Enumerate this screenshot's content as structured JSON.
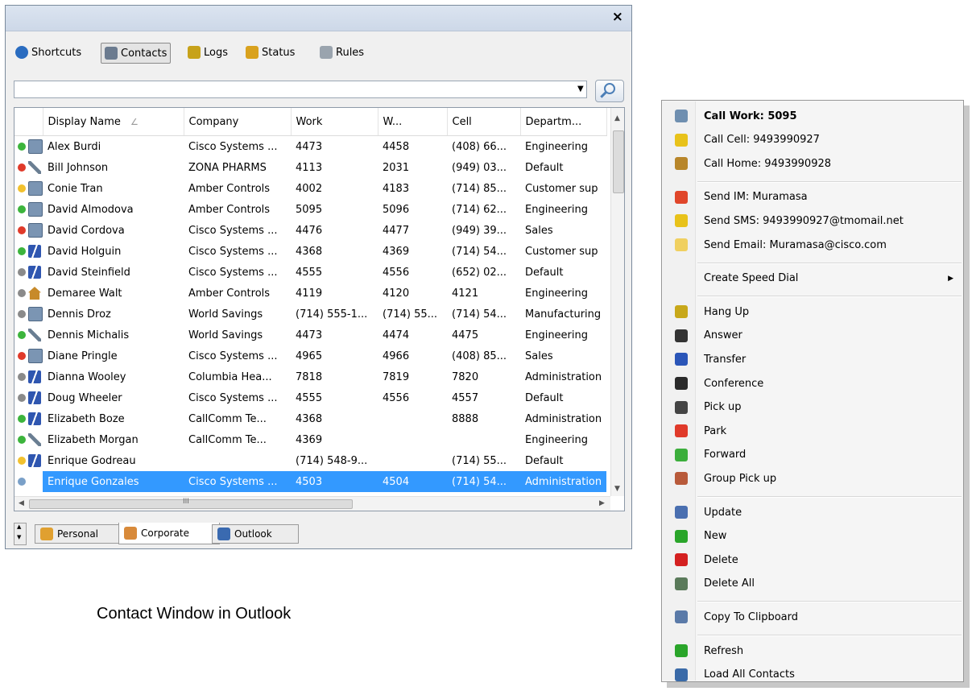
{
  "window": {
    "close_label": "×",
    "tabs": [
      {
        "label": "Shortcuts",
        "icon": "info-icon",
        "color": "#2a6cc0"
      },
      {
        "label": "Contacts",
        "icon": "contacts-card-icon",
        "color": "#6b7b8f"
      },
      {
        "label": "Logs",
        "icon": "phone-log-icon",
        "color": "#c7a21a"
      },
      {
        "label": "Status",
        "icon": "status-people-icon",
        "color": "#d9a21e"
      },
      {
        "label": "Rules",
        "icon": "gear-icon",
        "color": "#9aa4ae"
      }
    ],
    "search": {
      "value": "",
      "placeholder": ""
    },
    "table": {
      "columns": [
        "Display Name",
        "Company",
        "Work",
        "W...",
        "Cell",
        "Departm..."
      ],
      "rows": [
        {
          "status": "#3cb43c",
          "type": "building",
          "name": "Alex Burdi",
          "company": "Cisco Systems ...",
          "work": "4473",
          "w": "4458",
          "cell": "(408) 66...",
          "dept": "Engineering"
        },
        {
          "status": "#e03a2a",
          "type": "satellite",
          "name": "Bill Johnson",
          "company": "ZONA PHARMS",
          "work": "4113",
          "w": "2031",
          "cell": "(949) 03...",
          "dept": "Default"
        },
        {
          "status": "#f2c12e",
          "type": "building",
          "name": "Conie Tran",
          "company": "Amber Controls",
          "work": "4002",
          "w": "4183",
          "cell": "(714) 85...",
          "dept": "Customer sup"
        },
        {
          "status": "#3cb43c",
          "type": "building",
          "name": "David Almodova",
          "company": "Amber Controls",
          "work": "5095",
          "w": "5096",
          "cell": "(714) 62...",
          "dept": "Engineering"
        },
        {
          "status": "#e03a2a",
          "type": "building",
          "name": "David Cordova",
          "company": "Cisco Systems ...",
          "work": "4476",
          "w": "4477",
          "cell": "(949) 39...",
          "dept": "Sales"
        },
        {
          "status": "#3cb43c",
          "type": "mobile",
          "name": "David Holguin",
          "company": "Cisco Systems ...",
          "work": "4368",
          "w": "4369",
          "cell": "(714) 54...",
          "dept": "Customer sup"
        },
        {
          "status": "#8a8a8a",
          "type": "mobile",
          "name": "David Steinfield",
          "company": "Cisco Systems ...",
          "work": "4555",
          "w": "4556",
          "cell": "(652) 02...",
          "dept": "Default"
        },
        {
          "status": "#8a8a8a",
          "type": "home",
          "name": "Demaree  Walt",
          "company": "Amber Controls",
          "work": "4119",
          "w": "4120",
          "cell": "4121",
          "dept": "Engineering"
        },
        {
          "status": "#8a8a8a",
          "type": "building",
          "name": "Dennis Droz",
          "company": "World Savings",
          "work": "(714) 555-1...",
          "w": "(714) 55...",
          "cell": "(714) 54...",
          "dept": "Manufacturing"
        },
        {
          "status": "#3cb43c",
          "type": "satellite",
          "name": "Dennis Michalis",
          "company": "World Savings",
          "work": "4473",
          "w": "4474",
          "cell": "4475",
          "dept": "Engineering"
        },
        {
          "status": "#e03a2a",
          "type": "building",
          "name": "Diane Pringle",
          "company": "Cisco Systems ...",
          "work": "4965",
          "w": "4966",
          "cell": "(408) 85...",
          "dept": "Sales"
        },
        {
          "status": "#8a8a8a",
          "type": "mobile",
          "name": "Dianna Wooley",
          "company": "Columbia Hea...",
          "work": "7818",
          "w": "7819",
          "cell": "7820",
          "dept": "Administration"
        },
        {
          "status": "#8a8a8a",
          "type": "mobile",
          "name": "Doug Wheeler",
          "company": "Cisco Systems ...",
          "work": "4555",
          "w": "4556",
          "cell": "4557",
          "dept": "Default"
        },
        {
          "status": "#3cb43c",
          "type": "mobile",
          "name": "Elizabeth Boze",
          "company": "CallComm Te...",
          "work": "4368",
          "w": "",
          "cell": "8888",
          "dept": "Administration"
        },
        {
          "status": "#3cb43c",
          "type": "satellite",
          "name": "Elizabeth Morgan",
          "company": "CallComm Te...",
          "work": "4369",
          "w": "",
          "cell": "",
          "dept": "Engineering"
        },
        {
          "status": "#f2c12e",
          "type": "mobile",
          "name": "Enrique Godreau",
          "company": "",
          "work": "(714) 548-9...",
          "w": "",
          "cell": "(714) 55...",
          "dept": "Default"
        },
        {
          "status": "#7aa0c8",
          "type": "none",
          "name": "Enrique Gonzales",
          "company": "Cisco Systems ...",
          "work": "4503",
          "w": "4504",
          "cell": "(714) 54...",
          "dept": "Administration",
          "selected": true
        }
      ]
    },
    "hscroll_mark": "III",
    "bottom_tabs": [
      {
        "label": "Personal",
        "icon": "person-icon"
      },
      {
        "label": "Corporate",
        "icon": "people-group-icon"
      },
      {
        "label": "Outlook",
        "icon": "outlook-card-icon"
      }
    ]
  },
  "caption": "Contact Window in Outlook",
  "menu": {
    "items": [
      {
        "label": "Call Work: 5095",
        "icon": "building-icon",
        "color": "#6f8fb0",
        "bold": true
      },
      {
        "label": "Call Cell: 9493990927",
        "icon": "cell-phone-icon",
        "color": "#e8c21a"
      },
      {
        "label": "Call Home: 9493990928",
        "icon": "home-icon",
        "color": "#b8862a"
      },
      {
        "sep": true
      },
      {
        "label": "Send IM: Muramasa",
        "icon": "im-person-icon",
        "color": "#e0462a"
      },
      {
        "label": "Send SMS: 9493990927@tmomail.net",
        "icon": "envelope-icon",
        "color": "#e8c21a"
      },
      {
        "label": "Send Email: Muramasa@cisco.com",
        "icon": "email-icon",
        "color": "#f0d060"
      },
      {
        "sep": true
      },
      {
        "label": "Create Speed Dial",
        "icon": "none",
        "color": "",
        "submenu": "▶"
      },
      {
        "sep": true
      },
      {
        "label": "Hang Up",
        "icon": "hang-up-icon",
        "color": "#c8a81a"
      },
      {
        "label": "Answer",
        "icon": "answer-icon",
        "color": "#333333"
      },
      {
        "label": "Transfer",
        "icon": "transfer-icon",
        "color": "#2a55b8"
      },
      {
        "label": "Conference",
        "icon": "conference-icon",
        "color": "#2a2a2a"
      },
      {
        "label": "Pick up",
        "icon": "pickup-icon",
        "color": "#444444"
      },
      {
        "label": "Park",
        "icon": "park-icon",
        "color": "#e03a2a"
      },
      {
        "label": "Forward",
        "icon": "forward-icon",
        "color": "#3cae3c"
      },
      {
        "label": "Group Pick up",
        "icon": "group-pickup-icon",
        "color": "#b85a3a"
      },
      {
        "sep": true
      },
      {
        "label": "Update",
        "icon": "update-icon",
        "color": "#4a6fb0"
      },
      {
        "label": "New",
        "icon": "plus-icon",
        "color": "#2aa52a"
      },
      {
        "label": "Delete",
        "icon": "delete-x-icon",
        "color": "#d42020"
      },
      {
        "label": "Delete All",
        "icon": "trash-icon",
        "color": "#5a7a5a"
      },
      {
        "sep": true
      },
      {
        "label": "Copy To Clipboard",
        "icon": "clipboard-icon",
        "color": "#5a7aa8"
      },
      {
        "sep": true
      },
      {
        "label": "Refresh",
        "icon": "refresh-icon",
        "color": "#2aa52a"
      },
      {
        "label": "Load All Contacts",
        "icon": "contacts-list-icon",
        "color": "#3a6aa8"
      }
    ]
  }
}
